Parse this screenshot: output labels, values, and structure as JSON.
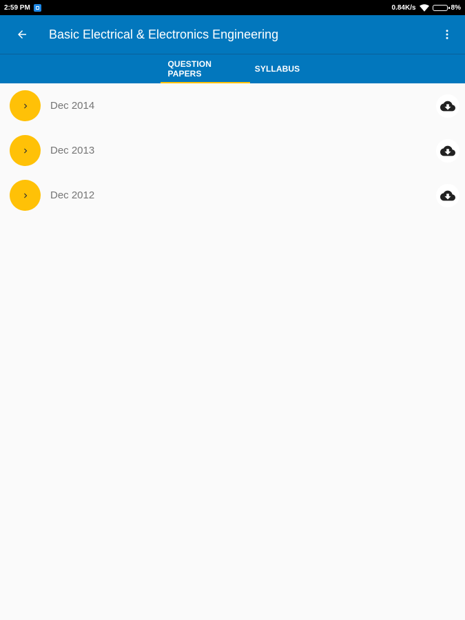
{
  "status_bar": {
    "time": "2:59 PM",
    "network_speed": "0.84K/s",
    "battery": "8%"
  },
  "app_bar": {
    "title": "Basic Electrical & Electronics Engineering",
    "back_icon": "arrow-back-icon",
    "menu_icon": "more-vert-icon"
  },
  "tabs": [
    {
      "label": "QUESTION PAPERS",
      "active": true
    },
    {
      "label": "SYLLABUS",
      "active": false
    }
  ],
  "papers": [
    {
      "label": "Dec 2014"
    },
    {
      "label": "Dec 2013"
    },
    {
      "label": "Dec 2012"
    }
  ],
  "colors": {
    "primary": "#0277bd",
    "accent": "#ffc107",
    "background": "#fafafa"
  }
}
